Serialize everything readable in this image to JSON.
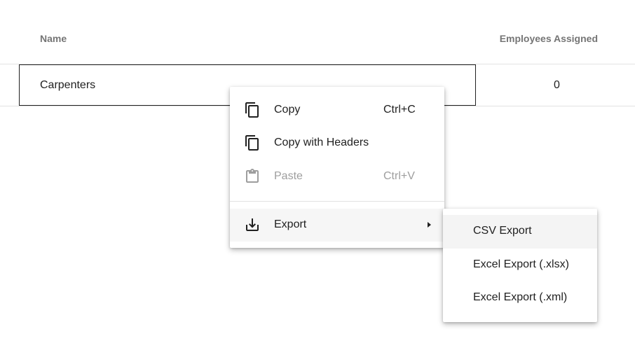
{
  "grid": {
    "columns": [
      "Name",
      "Employees Assigned"
    ],
    "rows": [
      {
        "name": "Carpenters",
        "employees_assigned": "0"
      }
    ]
  },
  "context_menu": {
    "items": [
      {
        "label": "Copy",
        "shortcut": "Ctrl+C",
        "icon": "copy-icon"
      },
      {
        "label": "Copy with Headers",
        "shortcut": "",
        "icon": "copy-icon"
      },
      {
        "label": "Paste",
        "shortcut": "Ctrl+V",
        "icon": "clipboard-icon",
        "disabled": true
      },
      {
        "label": "Export",
        "icon": "download-icon",
        "has_submenu": true
      }
    ]
  },
  "export_submenu": {
    "items": [
      "CSV Export",
      "Excel Export (.xlsx)",
      "Excel Export (.xml)"
    ]
  },
  "colors": {
    "text": "#212121",
    "header_text": "#757575",
    "disabled_text": "#9e9e9e",
    "row_border": "#e2e2e2"
  }
}
